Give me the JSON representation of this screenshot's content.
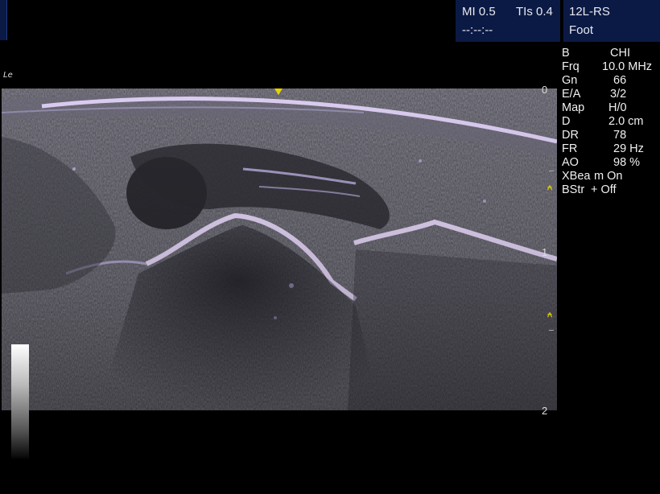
{
  "header": {
    "mi_label": "MI 0.5",
    "tis_label": "TIs 0.4",
    "clock": "--:--:--",
    "probe": "12L-RS",
    "preset": "Foot"
  },
  "probe_orientation": "Le",
  "params": [
    {
      "key": "B",
      "value": "CHI"
    },
    {
      "key": "Frq",
      "value": "10.0 MHz"
    },
    {
      "key": "Gn",
      "value": "66"
    },
    {
      "key": "E/A",
      "value": "3/2"
    },
    {
      "key": "Map",
      "value": "H/0"
    },
    {
      "key": "D",
      "value": "2.0 cm"
    },
    {
      "key": "DR",
      "value": "78"
    },
    {
      "key": "FR",
      "value": "29 Hz"
    },
    {
      "key": "AO",
      "value": "98 %"
    },
    {
      "key": "XBea",
      "value": "m On"
    },
    {
      "key": "BStr",
      "value": "+ Off"
    }
  ],
  "depth_scale": {
    "labels": [
      "0",
      "1",
      "2"
    ],
    "unit_max_cm": 2.0
  },
  "colors": {
    "tissue_tint": "#c8b8ff",
    "focus_marker": "#d8c800",
    "header_bg": "#0b1a44"
  }
}
